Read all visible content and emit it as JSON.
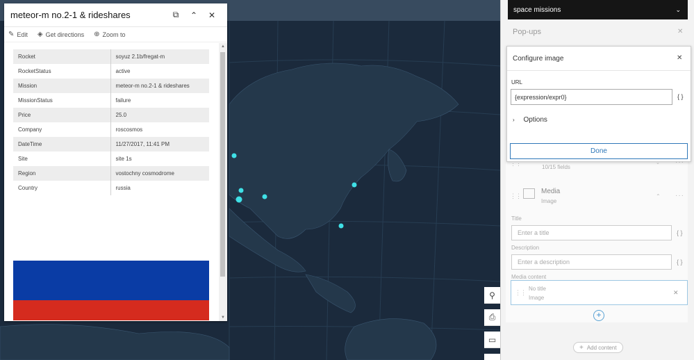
{
  "popup": {
    "title": "meteor-m no.2-1 & rideshares",
    "actions": {
      "edit": "Edit",
      "directions": "Get directions",
      "zoom": "Zoom to"
    },
    "attributes": [
      {
        "key": "Rocket",
        "value": "soyuz 2.1b/fregat-m"
      },
      {
        "key": "RocketStatus",
        "value": "active"
      },
      {
        "key": "Mission",
        "value": "meteor-m no.2-1 & rideshares"
      },
      {
        "key": "MissionStatus",
        "value": "failure"
      },
      {
        "key": "Price",
        "value": "25.0"
      },
      {
        "key": "Company",
        "value": "roscosmos"
      },
      {
        "key": "DateTime",
        "value": "11/27/2017, 11:41 PM"
      },
      {
        "key": "Site",
        "value": "site 1s"
      },
      {
        "key": "Region",
        "value": "vostochny cosmodrome"
      },
      {
        "key": "Country",
        "value": "russia"
      }
    ],
    "flag_colors": {
      "white": "#ffffff",
      "blue": "#0a3ca5",
      "red": "#d52b1e"
    }
  },
  "map": {
    "point_color": "#3fe0e6"
  },
  "panel": {
    "layer": "space missions",
    "section_title": "Pop-ups",
    "fields_sub": "10/15 fields",
    "media_title": "Media",
    "media_sub": "Image",
    "title_label": "Title",
    "title_placeholder": "Enter a title",
    "description_label": "Description",
    "description_placeholder": "Enter a description",
    "media_content_label": "Media content",
    "media_item_title": "No title",
    "media_item_sub": "Image",
    "add_content": "Add content",
    "brace": "{ }"
  },
  "dialog": {
    "title": "Configure image",
    "url_label": "URL",
    "url_value": "{expression/expr0}",
    "options_label": "Options",
    "done_label": "Done"
  },
  "colors": {
    "accent": "#2e77b8"
  }
}
